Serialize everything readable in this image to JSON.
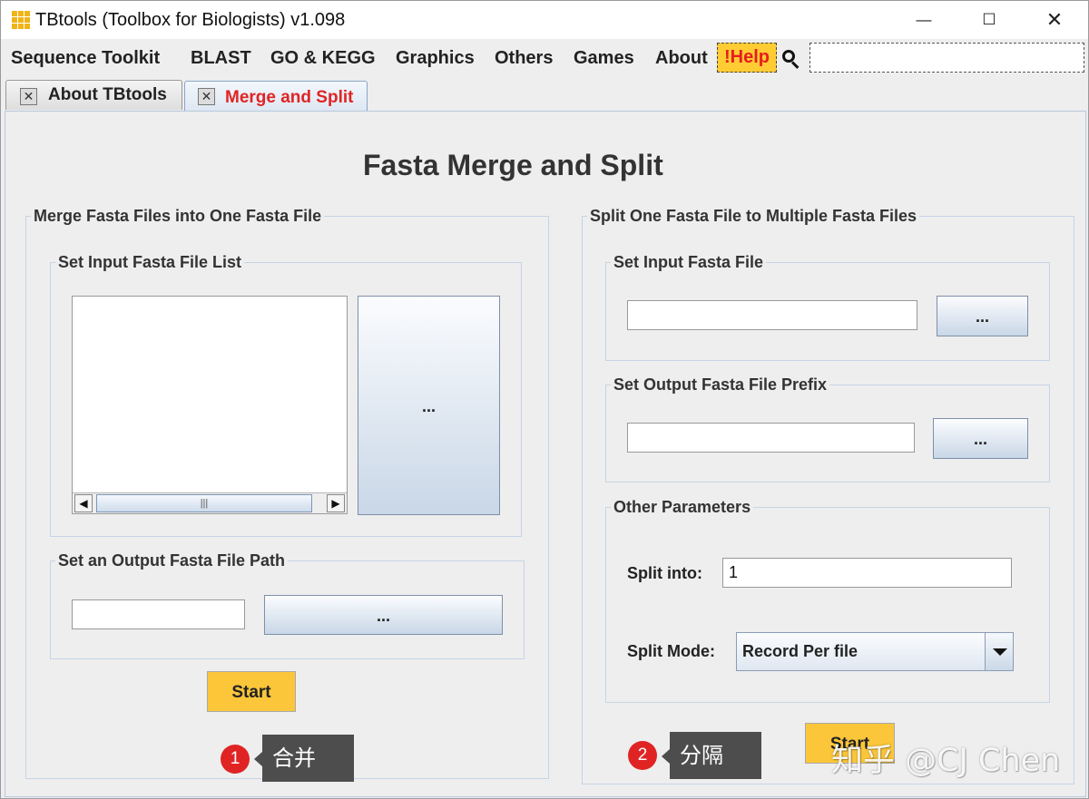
{
  "window": {
    "title": "TBtools (Toolbox for Biologists) v1.098",
    "minimize_glyph": "—",
    "maximize_glyph": "☐",
    "close_glyph": "✕"
  },
  "menubar": {
    "items": [
      "Sequence Toolkit",
      "BLAST",
      "GO & KEGG",
      "Graphics",
      "Others",
      "Games",
      "About"
    ],
    "help_label": "!Help",
    "search_value": ""
  },
  "tabs": [
    {
      "label": "About TBtools",
      "close_glyph": "✕"
    },
    {
      "label": "Merge and Split",
      "close_glyph": "✕",
      "active": true
    }
  ],
  "page": {
    "title": "Fasta Merge and Split"
  },
  "merge": {
    "legend": "Merge Fasta Files into One Fasta File",
    "input_list_legend": "Set Input Fasta File List",
    "browse_list_label": "...",
    "scroll_left": "◀",
    "scroll_right": "▶",
    "scroll_grip": "|||",
    "output_path_legend": "Set an Output Fasta File Path",
    "output_path_value": "",
    "browse_output_label": "...",
    "start_label": "Start"
  },
  "split": {
    "legend": "Split One Fasta File to Multiple Fasta Files",
    "input_file_legend": "Set Input Fasta File",
    "input_file_value": "",
    "browse_input_label": "...",
    "prefix_legend": "Set Output Fasta File Prefix",
    "prefix_value": "",
    "browse_prefix_label": "...",
    "params_legend": "Other Parameters",
    "split_into_label": "Split into:",
    "split_into_value": "1",
    "split_mode_label": "Split Mode:",
    "split_mode_value": "Record Per file",
    "start_label": "Start"
  },
  "annotations": [
    {
      "number": "1",
      "text": "合并"
    },
    {
      "number": "2",
      "text": "分隔"
    }
  ],
  "watermark": "知乎 @CJ Chen",
  "colors": {
    "accent_yellow": "#fbc63a",
    "help_red": "#e61e1e",
    "badge_red": "#e02424",
    "app_icon": "#f1b417"
  },
  "icons": {
    "app": "tbtools-grid-icon",
    "search": "search-icon",
    "combo": "chevron-down-icon"
  }
}
